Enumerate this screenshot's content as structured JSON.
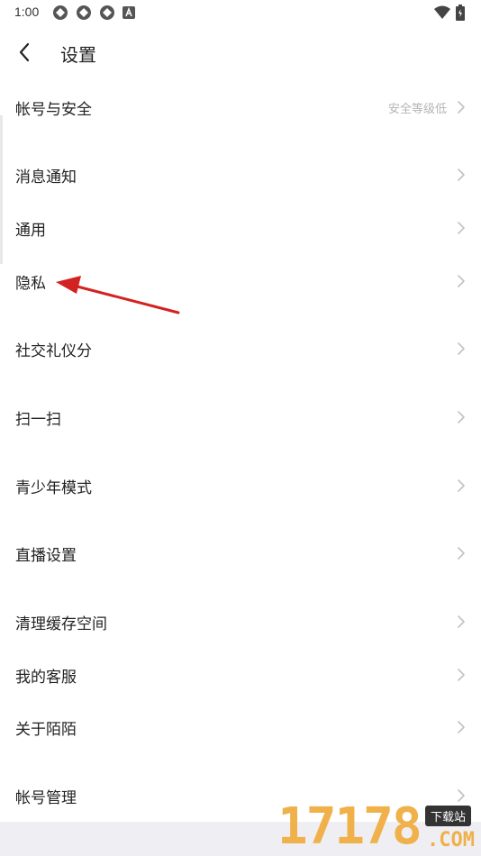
{
  "status_bar": {
    "time": "1:00",
    "notification_icons": [
      "network-icon",
      "network-icon",
      "network-icon",
      "a-icon"
    ],
    "right_icons": [
      "wifi-icon",
      "battery-icon"
    ]
  },
  "header": {
    "title": "设置"
  },
  "settings": {
    "items": [
      {
        "label": "帐号与安全",
        "value": "安全等级低"
      },
      {
        "label": "消息通知"
      },
      {
        "label": "通用"
      },
      {
        "label": "隐私"
      },
      {
        "label": "社交礼仪分"
      },
      {
        "label": "扫一扫"
      },
      {
        "label": "青少年模式"
      },
      {
        "label": "直播设置"
      },
      {
        "label": "清理缓存空间"
      },
      {
        "label": "我的客服"
      },
      {
        "label": "关于陌陌"
      },
      {
        "label": "帐号管理"
      }
    ]
  },
  "watermark": {
    "number": "17178",
    "badge": "下载站",
    "domain": ".COM"
  },
  "colors": {
    "annotation_arrow": "#d42121",
    "value_text": "#b4b4b4",
    "footer_bg": "#efeff3",
    "watermark": "#f0b04a"
  }
}
